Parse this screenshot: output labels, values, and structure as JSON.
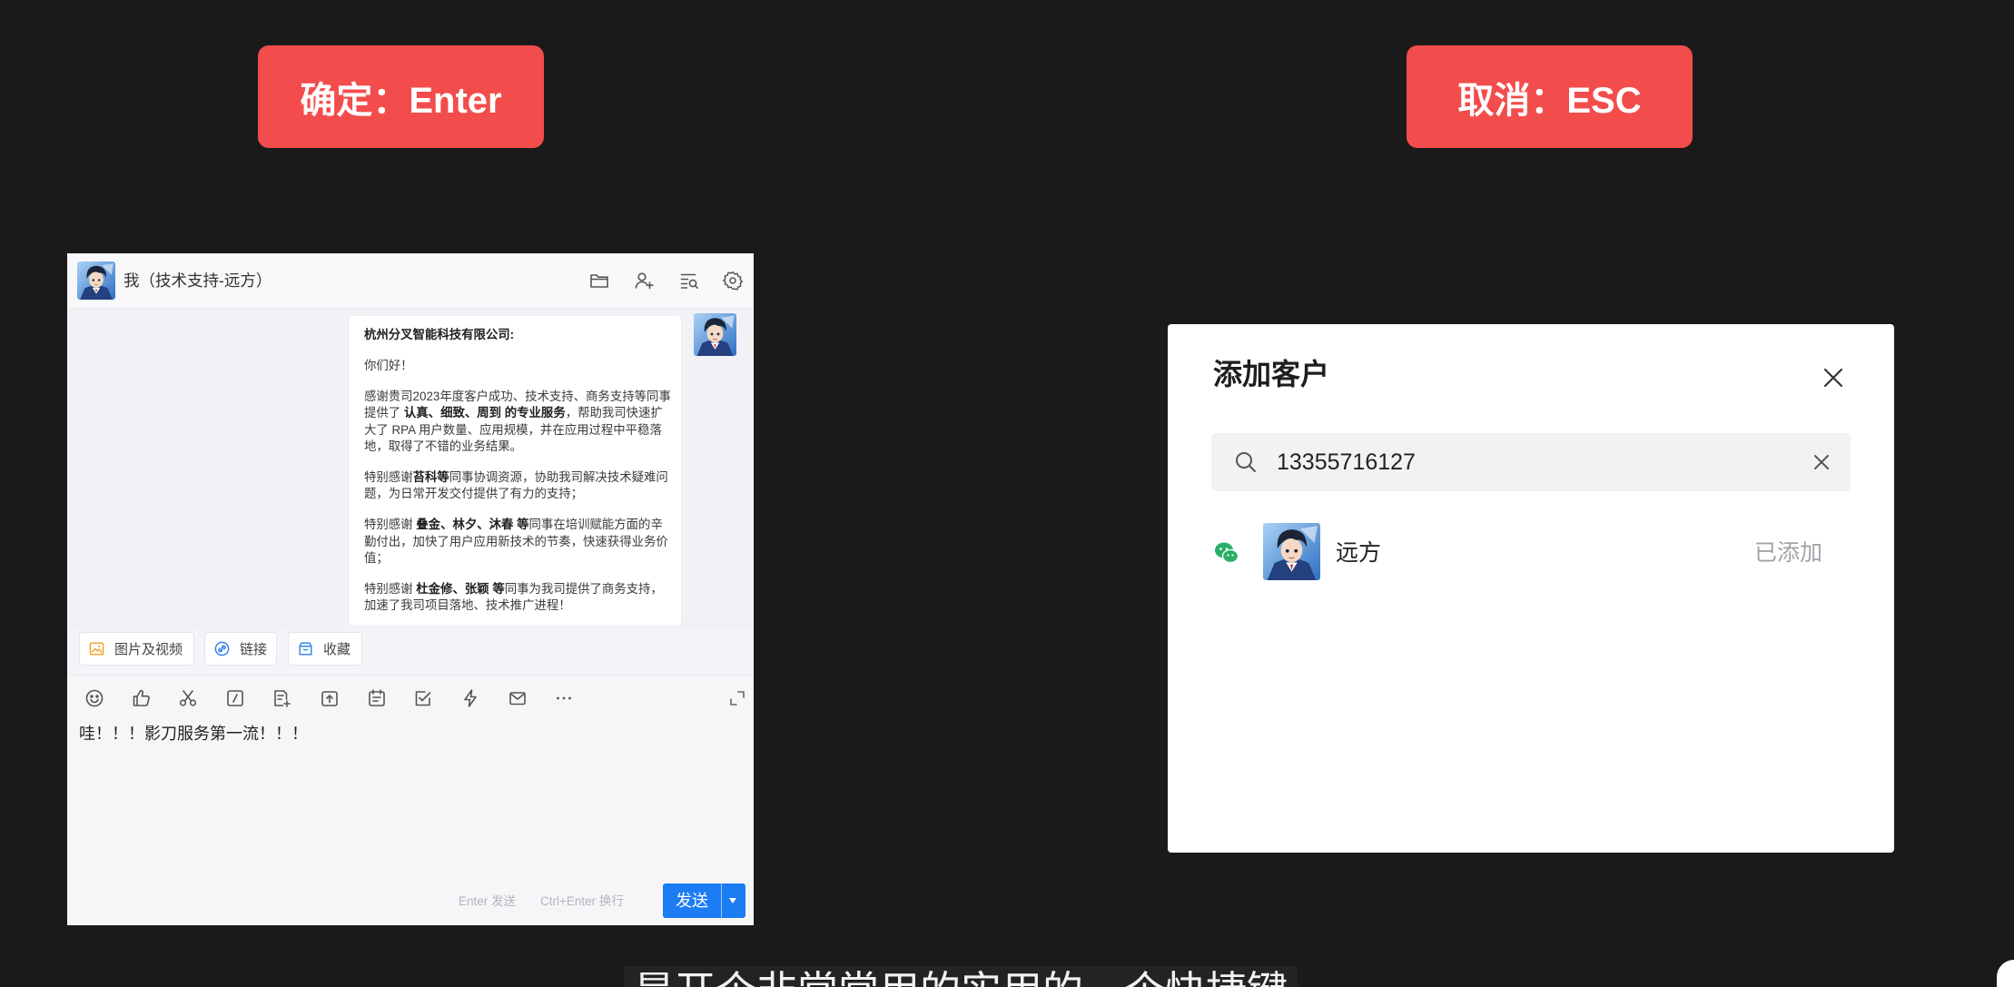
{
  "theme": {
    "badge": "#f24d4c",
    "send_button": "#1c7cf4",
    "wechat": "#2aae67"
  },
  "shortcuts": {
    "confirm_label": "确定：Enter",
    "cancel_label": "取消：ESC"
  },
  "chat": {
    "title": "我（技术支持-远方）",
    "header_icons": [
      "folder-icon",
      "add-member-icon",
      "chat-search-icon",
      "settings-icon"
    ],
    "message": {
      "paragraphs": [
        [
          [
            {
              "t": "杭州分叉智能科技有限公司:",
              "b": true
            }
          ]
        ],
        [
          [
            {
              "t": "你们好！"
            }
          ]
        ],
        [
          [
            {
              "t": "感谢贵司2023年度客户成功、技术支持、商务支持等同事"
            }
          ],
          [
            {
              "t": "提供了 "
            },
            {
              "t": "认真、细致、周到 的专业服务",
              "b": true
            },
            {
              "t": "，帮助我司快速扩"
            }
          ],
          [
            {
              "t": "大了 RPA 用户数量、应用规模，并在应用过程中平稳落"
            }
          ],
          [
            {
              "t": "地，取得了不错的业务结果。"
            }
          ]
        ],
        [
          [
            {
              "t": "特别感谢"
            },
            {
              "t": "苔科等",
              "b": true
            },
            {
              "t": "同事协调资源，协助我司解决技术疑难问"
            }
          ],
          [
            {
              "t": "题，为日常开发交付提供了有力的支持；"
            }
          ]
        ],
        [
          [
            {
              "t": "特别感谢 "
            },
            {
              "t": "叠金、林夕、沐春 等",
              "b": true
            },
            {
              "t": "同事在培训赋能方面的辛"
            }
          ],
          [
            {
              "t": "勤付出，加快了用户应用新技术的节奏，快速获得业务价"
            }
          ],
          [
            {
              "t": "值；"
            }
          ]
        ],
        [
          [
            {
              "t": "特别感谢 "
            },
            {
              "t": "杜金修、张颖 等",
              "b": true
            },
            {
              "t": "同事为我司提供了商务支持，"
            }
          ],
          [
            {
              "t": "加速了我司项目落地、技术推广进程！"
            }
          ]
        ]
      ]
    },
    "quick_actions": [
      {
        "label": "图片及视频",
        "icon": "image-icon"
      },
      {
        "label": "链接",
        "icon": "link-icon"
      },
      {
        "label": "收藏",
        "icon": "favorites-icon"
      }
    ],
    "toolbar_icons": [
      "emoji-icon",
      "thumbs-up-icon",
      "screenshot-icon",
      "quick-reply-icon",
      "add-document-icon",
      "upload-file-icon",
      "schedule-icon",
      "task-icon",
      "quick-action-icon",
      "email-icon",
      "more-icon"
    ],
    "input_value": "哇！！！影刀服务第一流！！！",
    "hint_send": "Enter 发送",
    "hint_newline": "Ctrl+Enter 换行",
    "send_label": "发送"
  },
  "dialog": {
    "title": "添加客户",
    "search_value": "13355716127",
    "results": [
      {
        "name": "远方",
        "status": "已添加",
        "channel_icon": "wechat-icon"
      }
    ]
  },
  "subtitle": "是开个非常常用的实用的一个快捷键"
}
